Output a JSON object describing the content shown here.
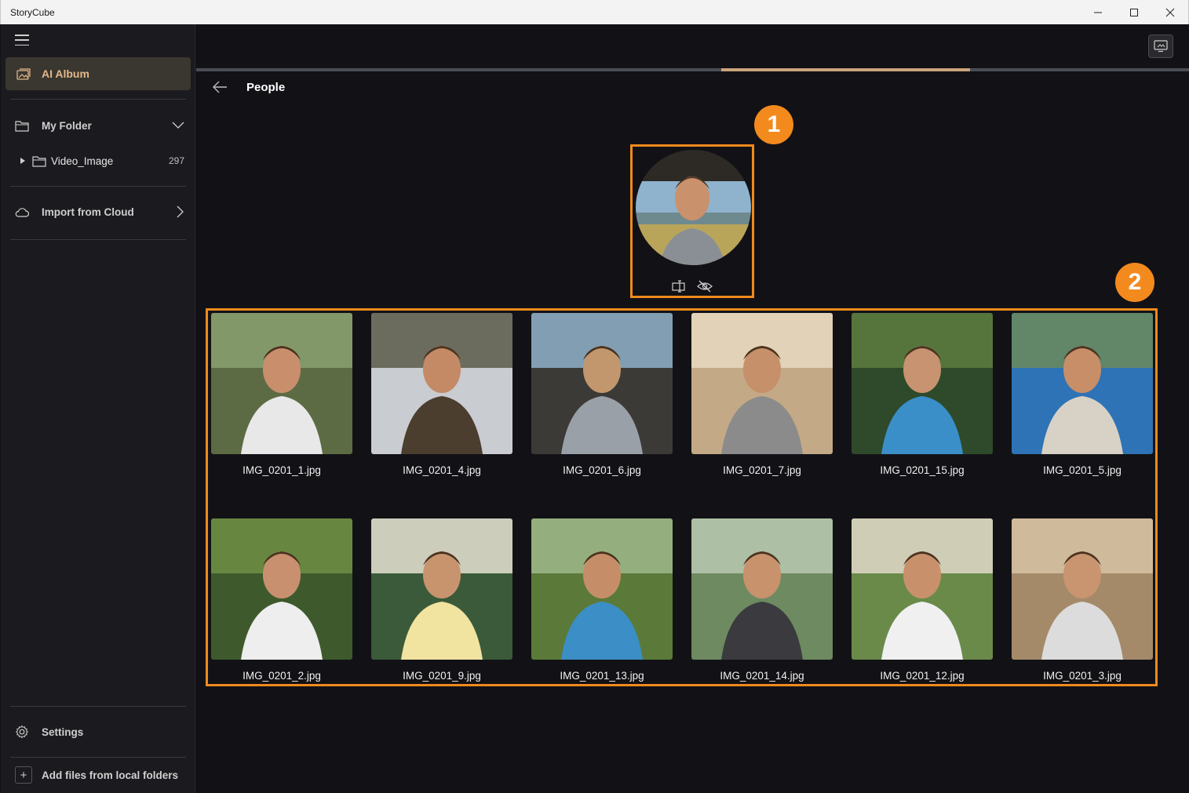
{
  "app": {
    "title": "StoryCube",
    "window_controls": [
      "minimize-icon",
      "maximize-icon",
      "close-icon"
    ]
  },
  "sidebar": {
    "ai_album_label": "AI Album",
    "my_folder_label": "My Folder",
    "folder": {
      "name": "Video_Image",
      "count": "297"
    },
    "import_cloud_label": "Import from Cloud",
    "settings_label": "Settings",
    "add_files_label": "Add files from local folders"
  },
  "main": {
    "page_title": "People",
    "progress": 0.25,
    "badges": {
      "one": "1",
      "two": "2"
    },
    "accent_color": "#f08a1c",
    "photos": [
      {
        "name": "IMG_0201_1.jpg"
      },
      {
        "name": "IMG_0201_4.jpg"
      },
      {
        "name": "IMG_0201_6.jpg"
      },
      {
        "name": "IMG_0201_7.jpg"
      },
      {
        "name": "IMG_0201_15.jpg"
      },
      {
        "name": "IMG_0201_5.jpg"
      },
      {
        "name": "IMG_0201_2.jpg"
      },
      {
        "name": "IMG_0201_9.jpg"
      },
      {
        "name": "IMG_0201_13.jpg"
      },
      {
        "name": "IMG_0201_14.jpg"
      },
      {
        "name": "IMG_0201_12.jpg"
      },
      {
        "name": "IMG_0201_3.jpg"
      }
    ]
  }
}
